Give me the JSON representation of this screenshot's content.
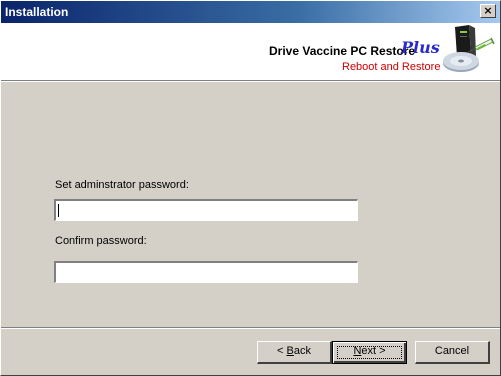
{
  "window": {
    "title": "Installation",
    "close_glyph": "×"
  },
  "header": {
    "product_name": "Drive Vaccine PC Restore",
    "product_edition": "Plus",
    "tagline": "Reboot and Restore",
    "logo_icon": "drive-vaccine-logo-icon"
  },
  "form": {
    "admin_password_label": "Set adminstrator password:",
    "admin_password_value": "",
    "confirm_password_label": "Confirm password:",
    "confirm_password_value": ""
  },
  "buttons": {
    "back_prefix": "< ",
    "back_accel": "B",
    "back_rest": "ack",
    "next_accel": "N",
    "next_rest": "ext >",
    "cancel": "Cancel"
  },
  "colors": {
    "titlebar_start": "#0a246a",
    "titlebar_end": "#a6caf0",
    "dialog_face": "#d4d0c8",
    "tagline": "#cc0000",
    "edition": "#2a2acc"
  }
}
